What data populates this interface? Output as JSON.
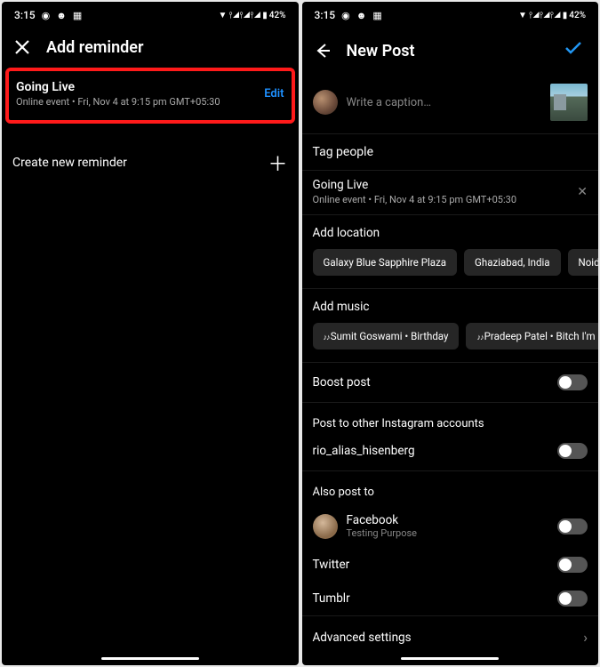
{
  "status": {
    "time": "3:15",
    "battery": "42%",
    "icons": [
      "reddit",
      "discord",
      "calendar"
    ]
  },
  "left_screen": {
    "title": "Add reminder",
    "reminder": {
      "title": "Going Live",
      "subtitle": "Online event • Fri, Nov 4 at 9:15 pm GMT+05:30",
      "edit": "Edit"
    },
    "create_new": "Create new reminder"
  },
  "right_screen": {
    "title": "New Post",
    "caption_placeholder": "Write a caption…",
    "tag_people": "Tag people",
    "reminder": {
      "title": "Going Live",
      "subtitle": "Online event • Fri, Nov 4 at 9:15 pm GMT+05:30"
    },
    "add_location": "Add location",
    "locations": [
      "Galaxy Blue Sapphire Plaza",
      "Ghaziabad, India",
      "Noida E"
    ],
    "add_music": "Add music",
    "music": [
      "Sumit Goswami • Birthday",
      "Pradeep Patel • Bitch I'm Back"
    ],
    "boost_post": "Boost post",
    "post_to_other": "Post to other Instagram accounts",
    "account": "rio_alias_hisenberg",
    "also_post_to": "Also post to",
    "facebook": {
      "label": "Facebook",
      "sub": "Testing Purpose"
    },
    "twitter": "Twitter",
    "tumblr": "Tumblr",
    "advanced": "Advanced settings"
  }
}
